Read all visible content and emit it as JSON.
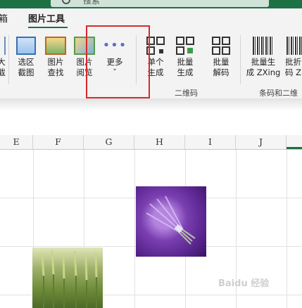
{
  "title_bar": {
    "search_text": "搜索"
  },
  "tabs": [
    {
      "label": "箱"
    },
    {
      "label": "图片工具",
      "active": true
    }
  ],
  "ribbon": {
    "buttons": [
      {
        "id": "crop",
        "line1": "大",
        "line2": "截"
      },
      {
        "id": "region-capture",
        "line1": "选区",
        "line2": "截图"
      },
      {
        "id": "image-search",
        "line1": "图片",
        "line2": "查找"
      },
      {
        "id": "image-viewer",
        "line1": "图片",
        "line2": "阅览"
      },
      {
        "id": "more",
        "line1": "更多",
        "line2": "ˇ",
        "icon_glyph": "•••"
      },
      {
        "id": "single-generate",
        "line1": "单个",
        "line2": "生成"
      },
      {
        "id": "batch-generate",
        "line1": "批量",
        "line2": "生成"
      },
      {
        "id": "batch-decode",
        "line1": "批量",
        "line2": "解码"
      },
      {
        "id": "batch-zxing",
        "line1": "批量生",
        "line2": "成 ZXing"
      },
      {
        "id": "batch-zxing-2",
        "line1": "批折",
        "line2": "码 Z"
      }
    ],
    "groups": [
      {
        "label": "二维码"
      },
      {
        "label": "条码和二维"
      }
    ]
  },
  "columns": [
    "E",
    "F",
    "G",
    "H",
    "I",
    "J"
  ],
  "watermark": "Baidu 经验",
  "colors": {
    "accent": "#1e7145",
    "highlight": "#d9292b",
    "more_dots": "#5b6fc0"
  }
}
